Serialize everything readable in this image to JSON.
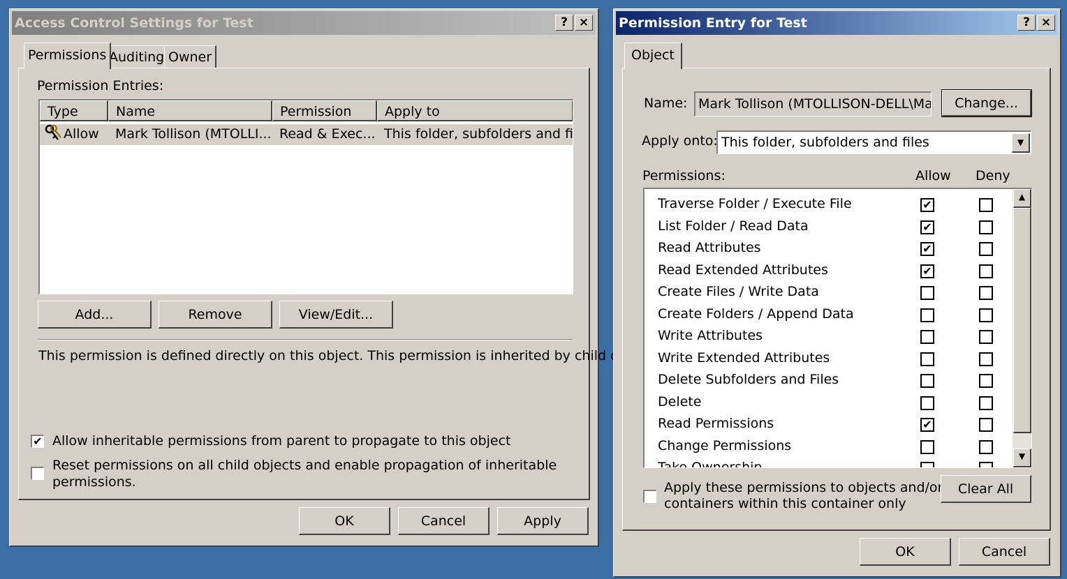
{
  "left_dialog": {
    "title": "Access Control Settings for Test",
    "help_btn": "?",
    "close_btn": "×",
    "tabs": [
      "Permissions",
      "Auditing",
      "Owner"
    ],
    "entries_label": "Permission Entries:",
    "columns": [
      "Type",
      "Name",
      "Permission",
      "Apply to"
    ],
    "rows": [
      {
        "type": "Allow",
        "name": "Mark Tollison (MTOLLI...",
        "permission": "Read & Exec...",
        "apply_to": "This folder, subfolders and files"
      }
    ],
    "add_label": "Add...",
    "remove_label": "Remove",
    "viewedit_label": "View/Edit...",
    "description": "This permission is defined directly on this object. This permission is inherited by child objects.",
    "inherit_label": "Allow inheritable permissions from parent to propagate to this object",
    "inherit_checked": true,
    "reset_label_1": "Reset permissions on all child objects and enable propagation of inheritable",
    "reset_label_2": "permissions.",
    "reset_checked": false,
    "ok_label": "OK",
    "cancel_label": "Cancel",
    "apply_label": "Apply"
  },
  "right_dialog": {
    "title": "Permission Entry for Test",
    "help_btn": "?",
    "close_btn": "×",
    "tab": "Object",
    "name_label": "Name:",
    "name_value": "Mark Tollison (MTOLLISON-DELL\\Mark",
    "change_label": "Change...",
    "apply_onto_label": "Apply onto:",
    "apply_onto_value": "This folder, subfolders and files",
    "permissions_label": "Permissions:",
    "allow_header": "Allow",
    "deny_header": "Deny",
    "permissions": [
      {
        "name": "Traverse Folder / Execute File",
        "allow": true,
        "deny": false
      },
      {
        "name": "List Folder / Read Data",
        "allow": true,
        "deny": false
      },
      {
        "name": "Read Attributes",
        "allow": true,
        "deny": false
      },
      {
        "name": "Read Extended Attributes",
        "allow": true,
        "deny": false
      },
      {
        "name": "Create Files / Write Data",
        "allow": false,
        "deny": false
      },
      {
        "name": "Create Folders / Append Data",
        "allow": false,
        "deny": false
      },
      {
        "name": "Write Attributes",
        "allow": false,
        "deny": false
      },
      {
        "name": "Write Extended Attributes",
        "allow": false,
        "deny": false
      },
      {
        "name": "Delete Subfolders and Files",
        "allow": false,
        "deny": false
      },
      {
        "name": "Delete",
        "allow": false,
        "deny": false
      },
      {
        "name": "Read Permissions",
        "allow": true,
        "deny": false
      },
      {
        "name": "Change Permissions",
        "allow": false,
        "deny": false
      },
      {
        "name": "Take Ownership",
        "allow": false,
        "deny": false
      }
    ],
    "apply_within_1": "Apply these permissions to objects and/or",
    "apply_within_2": "containers within this container only",
    "apply_within_checked": false,
    "clear_all_label": "Clear All",
    "ok_label": "OK",
    "cancel_label": "Cancel"
  },
  "icons": {
    "check_glyph": "✔",
    "scroll_up": "▲",
    "scroll_down": "▼",
    "dropdown": "▼"
  }
}
